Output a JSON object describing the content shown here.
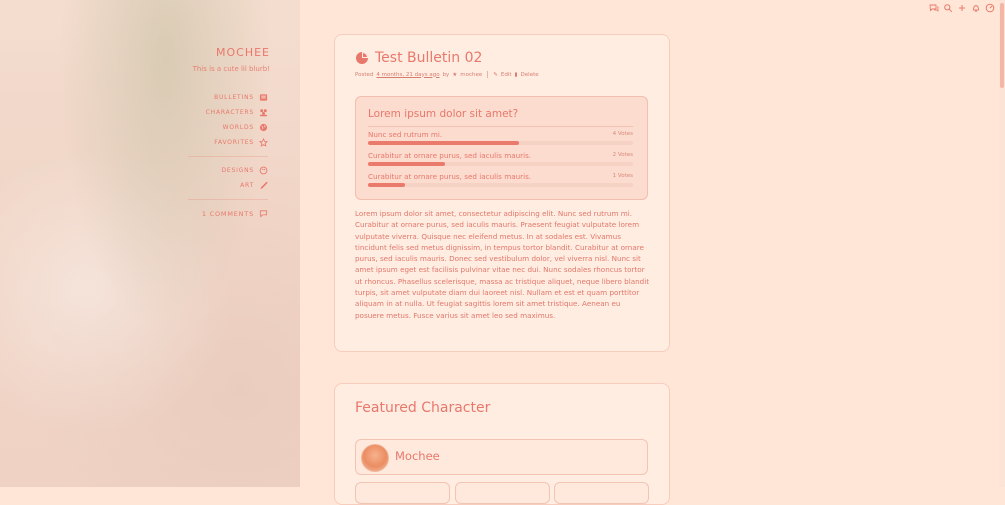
{
  "site": {
    "title": "MOCHEE",
    "blurb": "This is a cute lil blurb!"
  },
  "nav": {
    "items": [
      {
        "label": "BULLETINS",
        "icon": "newspaper-icon"
      },
      {
        "label": "CHARACTERS",
        "icon": "users-icon"
      },
      {
        "label": "WORLDS",
        "icon": "globe-icon"
      },
      {
        "label": "FAVORITES",
        "icon": "star-icon"
      }
    ],
    "items2": [
      {
        "label": "DESIGNS",
        "icon": "palette-icon"
      },
      {
        "label": "ART",
        "icon": "brush-icon"
      }
    ],
    "comments": "1 COMMENTS"
  },
  "top_icons": [
    "messages-icon",
    "search-icon",
    "plus-icon",
    "bell-icon",
    "dashboard-icon"
  ],
  "post": {
    "title": "Test Bulletin 02",
    "meta": {
      "posted": "Posted",
      "time": "4 months, 21 days ago",
      "by": "by",
      "author": "mochee",
      "edit": "Edit",
      "delete": "Delete"
    },
    "poll": {
      "question": "Lorem ipsum dolor sit amet?",
      "options": [
        {
          "label": "Nunc sed rutrum mi.",
          "votes": "4 Votes",
          "fraction": 0.57
        },
        {
          "label": "Curabitur at ornare purus, sed iaculis mauris.",
          "votes": "2 Votes",
          "fraction": 0.29
        },
        {
          "label": "Curabitur at ornare purus, sed iaculis mauris.",
          "votes": "1 Votes",
          "fraction": 0.14
        }
      ]
    },
    "body": "Lorem ipsum dolor sit amet, consectetur adipiscing elit. Nunc sed rutrum mi. Curabitur at ornare purus, sed iaculis mauris. Praesent feugiat vulputate lorem vulputate viverra. Quisque nec eleifend metus. In at sodales est. Vivamus tincidunt felis sed metus dignissim, in tempus tortor blandit. Curabitur at ornare purus, sed iaculis mauris. Donec sed vestibulum dolor, vel viverra nisl. Nunc sit amet ipsum eget est facilisis pulvinar vitae nec dui. Nunc sodales rhoncus tortor ut rhoncus. Phasellus scelerisque, massa ac tristique aliquet, neque libero blandit turpis, sit amet vulputate diam dui laoreet nisl. Nullam et est et quam porttitor aliquam in at nulla. Ut feugiat sagittis lorem sit amet tristique. Aenean eu posuere metus. Fusce varius sit amet leo sed maximus."
  },
  "featured": {
    "title": "Featured Character",
    "name": "Mochee"
  },
  "colors": {
    "accent": "#e8786c",
    "background": "#ffe6d6",
    "card": "#ffede2"
  }
}
